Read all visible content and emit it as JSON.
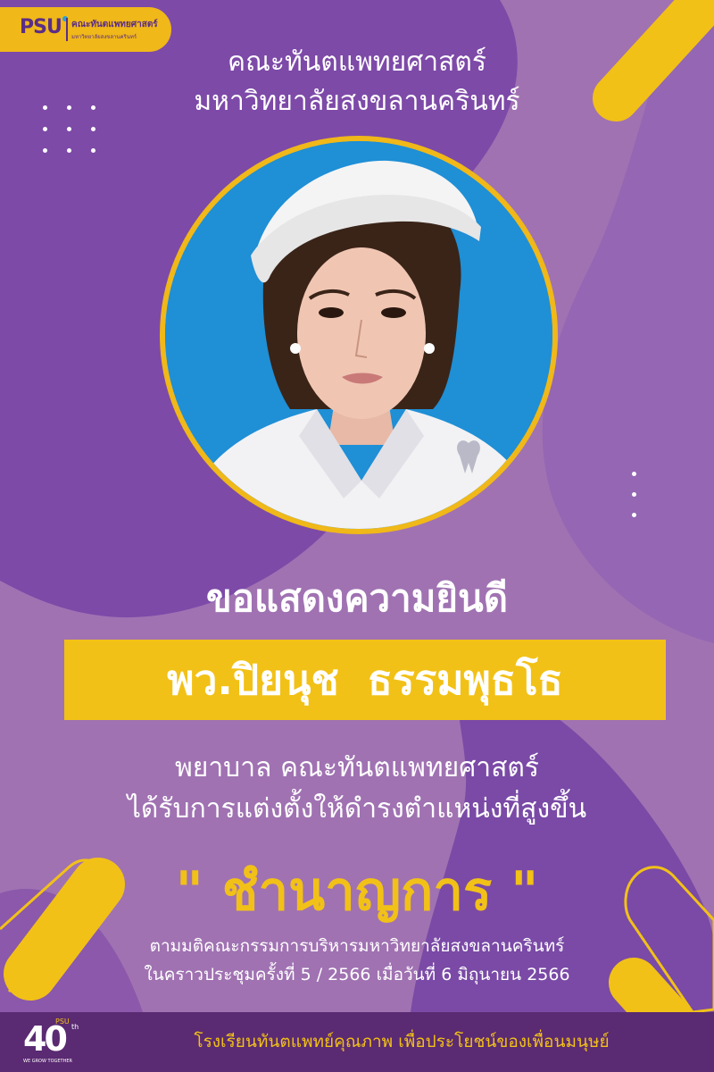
{
  "logo": {
    "mark": "PSU",
    "line1": "คณะทันตแพทยศาสตร์",
    "line2": "มหาวิทยาลัยสงขลานครินทร์"
  },
  "header": {
    "line1": "คณะทันตแพทยศาสตร์",
    "line2": "มหาวิทยาลัยสงขลานครินทร์"
  },
  "photo": {
    "subject": "portrait photo of nurse in white uniform and cap"
  },
  "congrats": "ขอแสดงความยินดี",
  "name": "พว.ปิยนุช  ธรรมพุธโธ",
  "description": {
    "line1": "พยาบาล คณะทันตแพทยศาสตร์",
    "line2": "ได้รับการแต่งตั้งให้ดำรงตำแหน่งที่สูงขึ้น"
  },
  "position_title": "\" ชำนาญการ \"",
  "resolution": {
    "line1": "ตามมติคณะกรรมการบริหารมหาวิทยาลัยสงขลานครินทร์",
    "line2": "ในคราวประชุมครั้งที่ 5 / 2566 เมื่อวันที่ 6 มิถุนายน 2566"
  },
  "footer": {
    "anniversary_number": "40",
    "anniversary_suffix": "th",
    "anniversary_mark": "PSU",
    "anniversary_tagline": "WE GROW TOGETHER",
    "slogan": "โรงเรียนทันตแพทย์คุณภาพ เพื่อประโยชน์ของเพื่อนมนุษย์"
  },
  "colors": {
    "purple_dark": "#7c4aa6",
    "purple_mid": "#9a66ad",
    "purple_light": "#a579b4",
    "accent_yellow": "#f2c117",
    "footer_purple": "#5a2a72",
    "photo_blue": "#1f8fd6"
  }
}
